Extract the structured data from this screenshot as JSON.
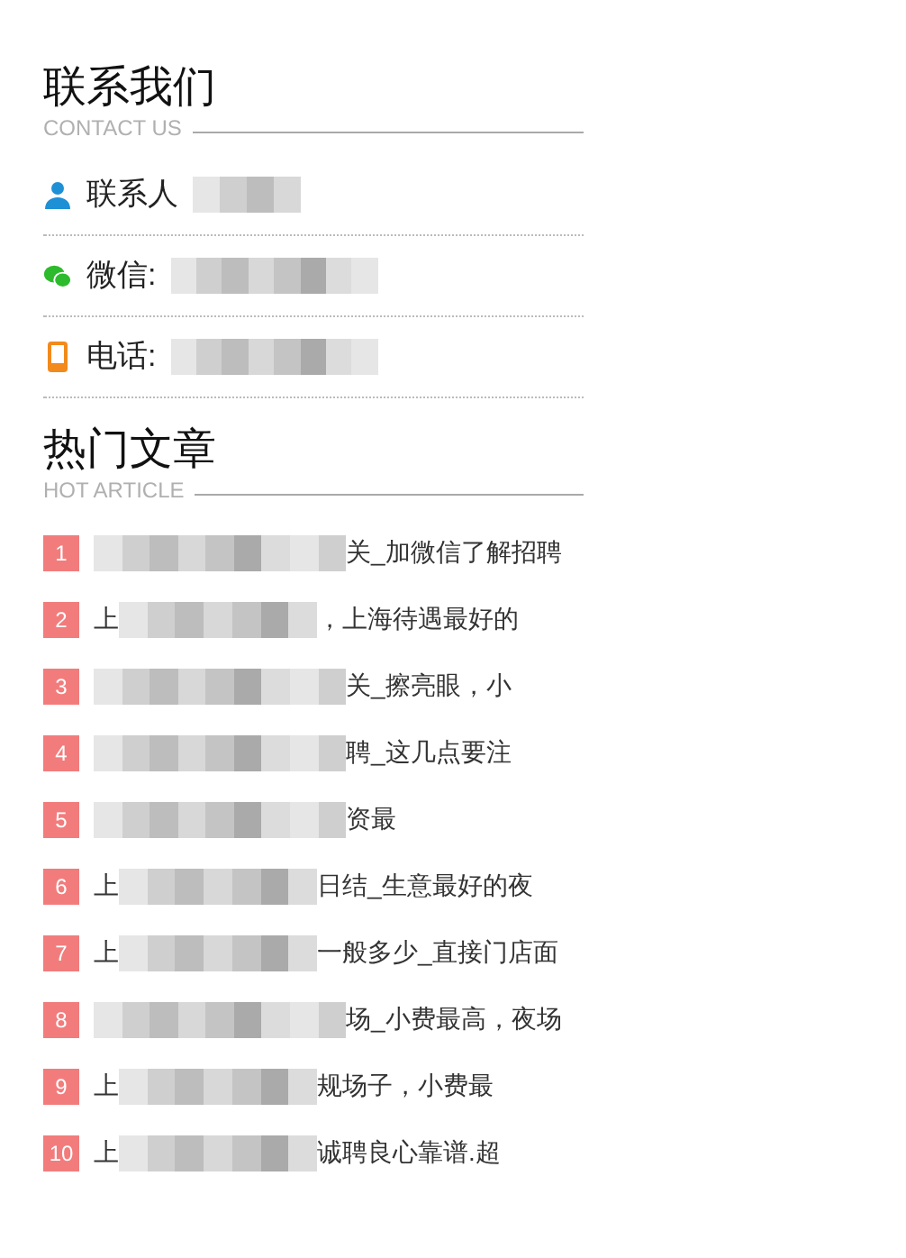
{
  "contact": {
    "title": "联系我们",
    "subtitle": "CONTACT US",
    "items": [
      {
        "kind": "person",
        "label": "联系人"
      },
      {
        "kind": "wechat",
        "label": "微信:"
      },
      {
        "kind": "phone",
        "label": "电话:"
      }
    ]
  },
  "articles": {
    "title": "热门文章",
    "subtitle": "HOT ARTICLE",
    "items": [
      {
        "rank": "1",
        "tail": "关_加微信了解招聘"
      },
      {
        "rank": "2",
        "lead": "上",
        "tail": "，上海待遇最好的"
      },
      {
        "rank": "3",
        "tail": "关_擦亮眼，小"
      },
      {
        "rank": "4",
        "tail": "聘_这几点要注"
      },
      {
        "rank": "5",
        "tail": "资最"
      },
      {
        "rank": "6",
        "lead": "上",
        "tail": "日结_生意最好的夜"
      },
      {
        "rank": "7",
        "lead": "上",
        "tail": "一般多少_直接门店面"
      },
      {
        "rank": "8",
        "tail": "场_小费最高，夜场"
      },
      {
        "rank": "9",
        "lead": "上",
        "tail": "规场子，小费最"
      },
      {
        "rank": "10",
        "lead": "上",
        "tail": "诚聘良心靠谱.超"
      }
    ]
  }
}
